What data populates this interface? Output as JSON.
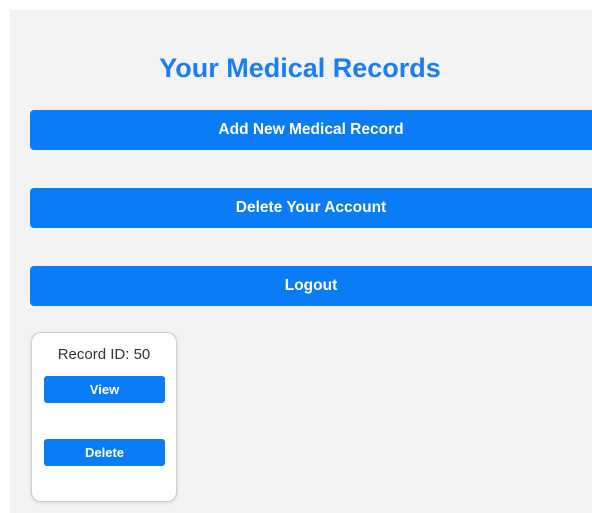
{
  "page": {
    "title": "Your Medical Records"
  },
  "actions": {
    "add_record_label": "Add New Medical Record",
    "delete_account_label": "Delete Your Account",
    "logout_label": "Logout"
  },
  "records": [
    {
      "id_text": "Record ID: 50",
      "view_label": "View",
      "delete_label": "Delete"
    }
  ],
  "colors": {
    "accent": "#0a7cf5",
    "title": "#1a7ef0",
    "panel_background": "#f3f3f3"
  }
}
